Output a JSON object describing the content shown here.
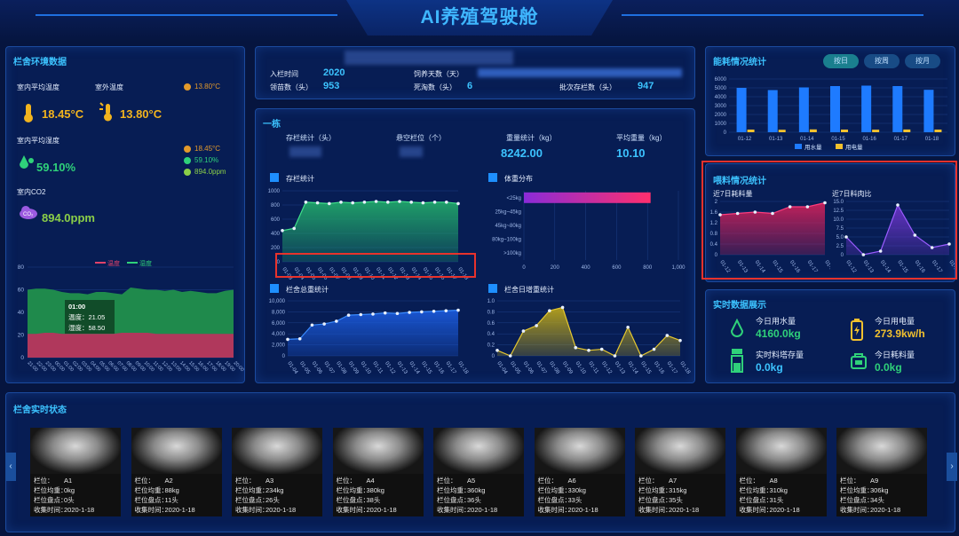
{
  "header": {
    "title": "AI养殖驾驶舱"
  },
  "colors": {
    "accent": "#3cc3ff",
    "water": "#1e7bff",
    "power": "#f2c12e",
    "green": "#2fd17a",
    "red_box": "#e8322c"
  },
  "env": {
    "title": "栏舍环境数据",
    "indoor_temp_label": "室内平均温度",
    "outdoor_temp_label": "室外温度",
    "outdoor_temp_small": "13.80°C",
    "indoor_temp": "18.45°C",
    "outdoor_temp": "13.80°C",
    "humidity_label": "室内平均湿度",
    "humidity": "59.10%",
    "co2_label": "室内CO2",
    "co2": "894.0ppm",
    "legend_list": [
      "18.45°C",
      "59.10%",
      "894.0ppm"
    ],
    "chart_legend": [
      "温度",
      "湿度"
    ],
    "tooltip_time": "01:00",
    "tooltip_temp": "温度：21.05",
    "tooltip_hum": "湿度：58.50",
    "y_ticks": [
      "80",
      "60",
      "40",
      "20",
      "0"
    ],
    "x_ticks": [
      "21:00",
      "22:00",
      "23:00",
      "00:00",
      "01:00",
      "02:00",
      "03:00",
      "04:00",
      "05:00",
      "06:00",
      "07:00",
      "08:00",
      "09:00",
      "10:00",
      "11:00",
      "12:00",
      "13:00",
      "14:00",
      "15:00",
      "16:00",
      "17:00",
      "18:00",
      "19:00",
      "20:00"
    ]
  },
  "info": {
    "entry_label": "入栏时间",
    "entry": "2020",
    "head_label": "领苗数（头）",
    "head": "953",
    "feed_days_label": "饲养天数（天）",
    "death_label": "死淘数（头）",
    "death": "6",
    "batch_label": "批次存栏数（头）",
    "batch": "947"
  },
  "unit": {
    "title": "一栋",
    "stock_label": "存栏统计（头）",
    "pen_label": "悬空栏位（个）",
    "weight_label": "重量统计（kg）",
    "weight": "8242.00",
    "avg_label": "平均重量（kg）",
    "avg": "10.10",
    "stock_chart_title": "存栏统计",
    "dist_title": "体重分布",
    "total_title": "栏舍总重统计",
    "gain_title": "栏舍日增重统计"
  },
  "energy": {
    "title": "能耗情况统计",
    "buttons": [
      "按日",
      "按周",
      "按月"
    ],
    "legend": [
      "用水量",
      "用电量"
    ]
  },
  "feed": {
    "title": "喂料情况统计",
    "left_title": "近7日耗料量",
    "right_title": "近7日料肉比"
  },
  "realtime": {
    "title": "实时数据展示",
    "water_label": "今日用水量",
    "water": "4160.0kg",
    "power_label": "今日用电量",
    "power": "273.9kw/h",
    "tower_label": "实时料塔存量",
    "tower": "0.0kg",
    "feed_label": "今日耗料量",
    "feed": "0.0kg"
  },
  "pens": {
    "title": "栏舍实时状态",
    "labels": {
      "pen": "栏位：",
      "weight": "栏位均重：",
      "count": "栏位盘点：",
      "time": "收集时间："
    },
    "items": [
      {
        "pen": "A1",
        "weight": "0kg",
        "count": "0头",
        "time": "2020-1-18"
      },
      {
        "pen": "A2",
        "weight": "88kg",
        "count": "11头",
        "time": "2020-1-18"
      },
      {
        "pen": "A3",
        "weight": "234kg",
        "count": "26头",
        "time": "2020-1-18"
      },
      {
        "pen": "A4",
        "weight": "380kg",
        "count": "38头",
        "time": "2020-1-18"
      },
      {
        "pen": "A5",
        "weight": "360kg",
        "count": "36头",
        "time": "2020-1-18"
      },
      {
        "pen": "A6",
        "weight": "330kg",
        "count": "33头",
        "time": "2020-1-18"
      },
      {
        "pen": "A7",
        "weight": "315kg",
        "count": "35头",
        "time": "2020-1-18"
      },
      {
        "pen": "A8",
        "weight": "310kg",
        "count": "31头",
        "time": "2020-1-18"
      },
      {
        "pen": "A9",
        "weight": "306kg",
        "count": "34头",
        "time": "2020-1-18"
      }
    ]
  },
  "chart_data": [
    {
      "id": "energy",
      "type": "bar",
      "categories": [
        "01-12",
        "01-13",
        "01-14",
        "01-15",
        "01-16",
        "01-17",
        "01-18"
      ],
      "series": [
        {
          "name": "用水量",
          "values": [
            5000,
            4750,
            5050,
            5200,
            5250,
            5200,
            4780
          ]
        },
        {
          "name": "用电量",
          "values": [
            300,
            280,
            320,
            300,
            290,
            310,
            300
          ]
        }
      ],
      "ylim": [
        0,
        6000
      ],
      "y_ticks": [
        0,
        1000,
        2000,
        3000,
        4000,
        5000,
        6000
      ]
    },
    {
      "id": "stock",
      "type": "area",
      "categories": [
        "01-03",
        "01-04",
        "01-05",
        "01-06",
        "01-07",
        "01-08",
        "01-09",
        "01-10",
        "01-11",
        "01-12",
        "01-13",
        "01-14",
        "01-15",
        "01-16",
        "01-17",
        "01-18"
      ],
      "values": [
        440,
        470,
        840,
        830,
        820,
        840,
        830,
        840,
        850,
        840,
        850,
        840,
        830,
        840,
        840,
        820
      ],
      "ylim": [
        0,
        1000
      ],
      "y_ticks": [
        0,
        200,
        400,
        600,
        800,
        1000
      ]
    },
    {
      "id": "dist",
      "type": "bar",
      "categories": [
        "<25kg",
        "25kg~45kg",
        "45kg~80kg",
        "80kg~100kg",
        ">100kg"
      ],
      "values": [
        820,
        0,
        0,
        0,
        0
      ],
      "xlim": [
        0,
        1000
      ],
      "x_ticks": [
        0,
        200,
        400,
        600,
        800,
        "1,000"
      ]
    },
    {
      "id": "total",
      "type": "area",
      "categories": [
        "01-04",
        "01-05",
        "01-06",
        "01-07",
        "01-08",
        "01-09",
        "01-10",
        "01-11",
        "01-12",
        "01-13",
        "01-14",
        "01-15",
        "01-16",
        "01-17",
        "01-18"
      ],
      "values": [
        3000,
        3100,
        5600,
        5800,
        6300,
        7400,
        7500,
        7600,
        7800,
        7700,
        7900,
        8000,
        8100,
        8200,
        8300
      ],
      "ylim": [
        0,
        10000
      ],
      "y_ticks": [
        "0",
        "2,000",
        "4,000",
        "6,000",
        "8,000",
        "10,000"
      ]
    },
    {
      "id": "gain",
      "type": "area",
      "categories": [
        "01-04",
        "01-05",
        "01-06",
        "01-07",
        "01-08",
        "01-09",
        "01-10",
        "01-11",
        "01-12",
        "01-13",
        "01-14",
        "01-15",
        "01-16",
        "01-17",
        "01-18"
      ],
      "values": [
        0.1,
        0.0,
        0.45,
        0.55,
        0.82,
        0.88,
        0.15,
        0.1,
        0.12,
        0.0,
        0.52,
        0.0,
        0.12,
        0.37,
        0.28
      ],
      "ylim": [
        0,
        1.0
      ],
      "y_ticks": [
        "0",
        "0.2",
        "0.4",
        "0.6",
        "0.8",
        "1.0"
      ]
    },
    {
      "id": "feed7",
      "type": "area",
      "categories": [
        "01-12",
        "01-13",
        "01-14",
        "01-15",
        "01-16",
        "01-17",
        "01-18"
      ],
      "values": [
        1.5,
        1.55,
        1.6,
        1.55,
        1.8,
        1.8,
        1.95
      ],
      "ylim": [
        0,
        2
      ],
      "y_ticks": [
        "0",
        "0.4",
        "0.8",
        "1.2",
        "1.6",
        "2"
      ]
    },
    {
      "id": "ratio7",
      "type": "area",
      "categories": [
        "01-12",
        "01-13",
        "01-14",
        "01-15",
        "01-16",
        "01-17",
        "01-18"
      ],
      "values": [
        5,
        0,
        1,
        14,
        5.5,
        2,
        3
      ],
      "ylim": [
        0,
        15
      ],
      "y_ticks": [
        "0",
        "2.5",
        "5.0",
        "7.5",
        "10.0",
        "12.5",
        "15.0"
      ]
    }
  ]
}
